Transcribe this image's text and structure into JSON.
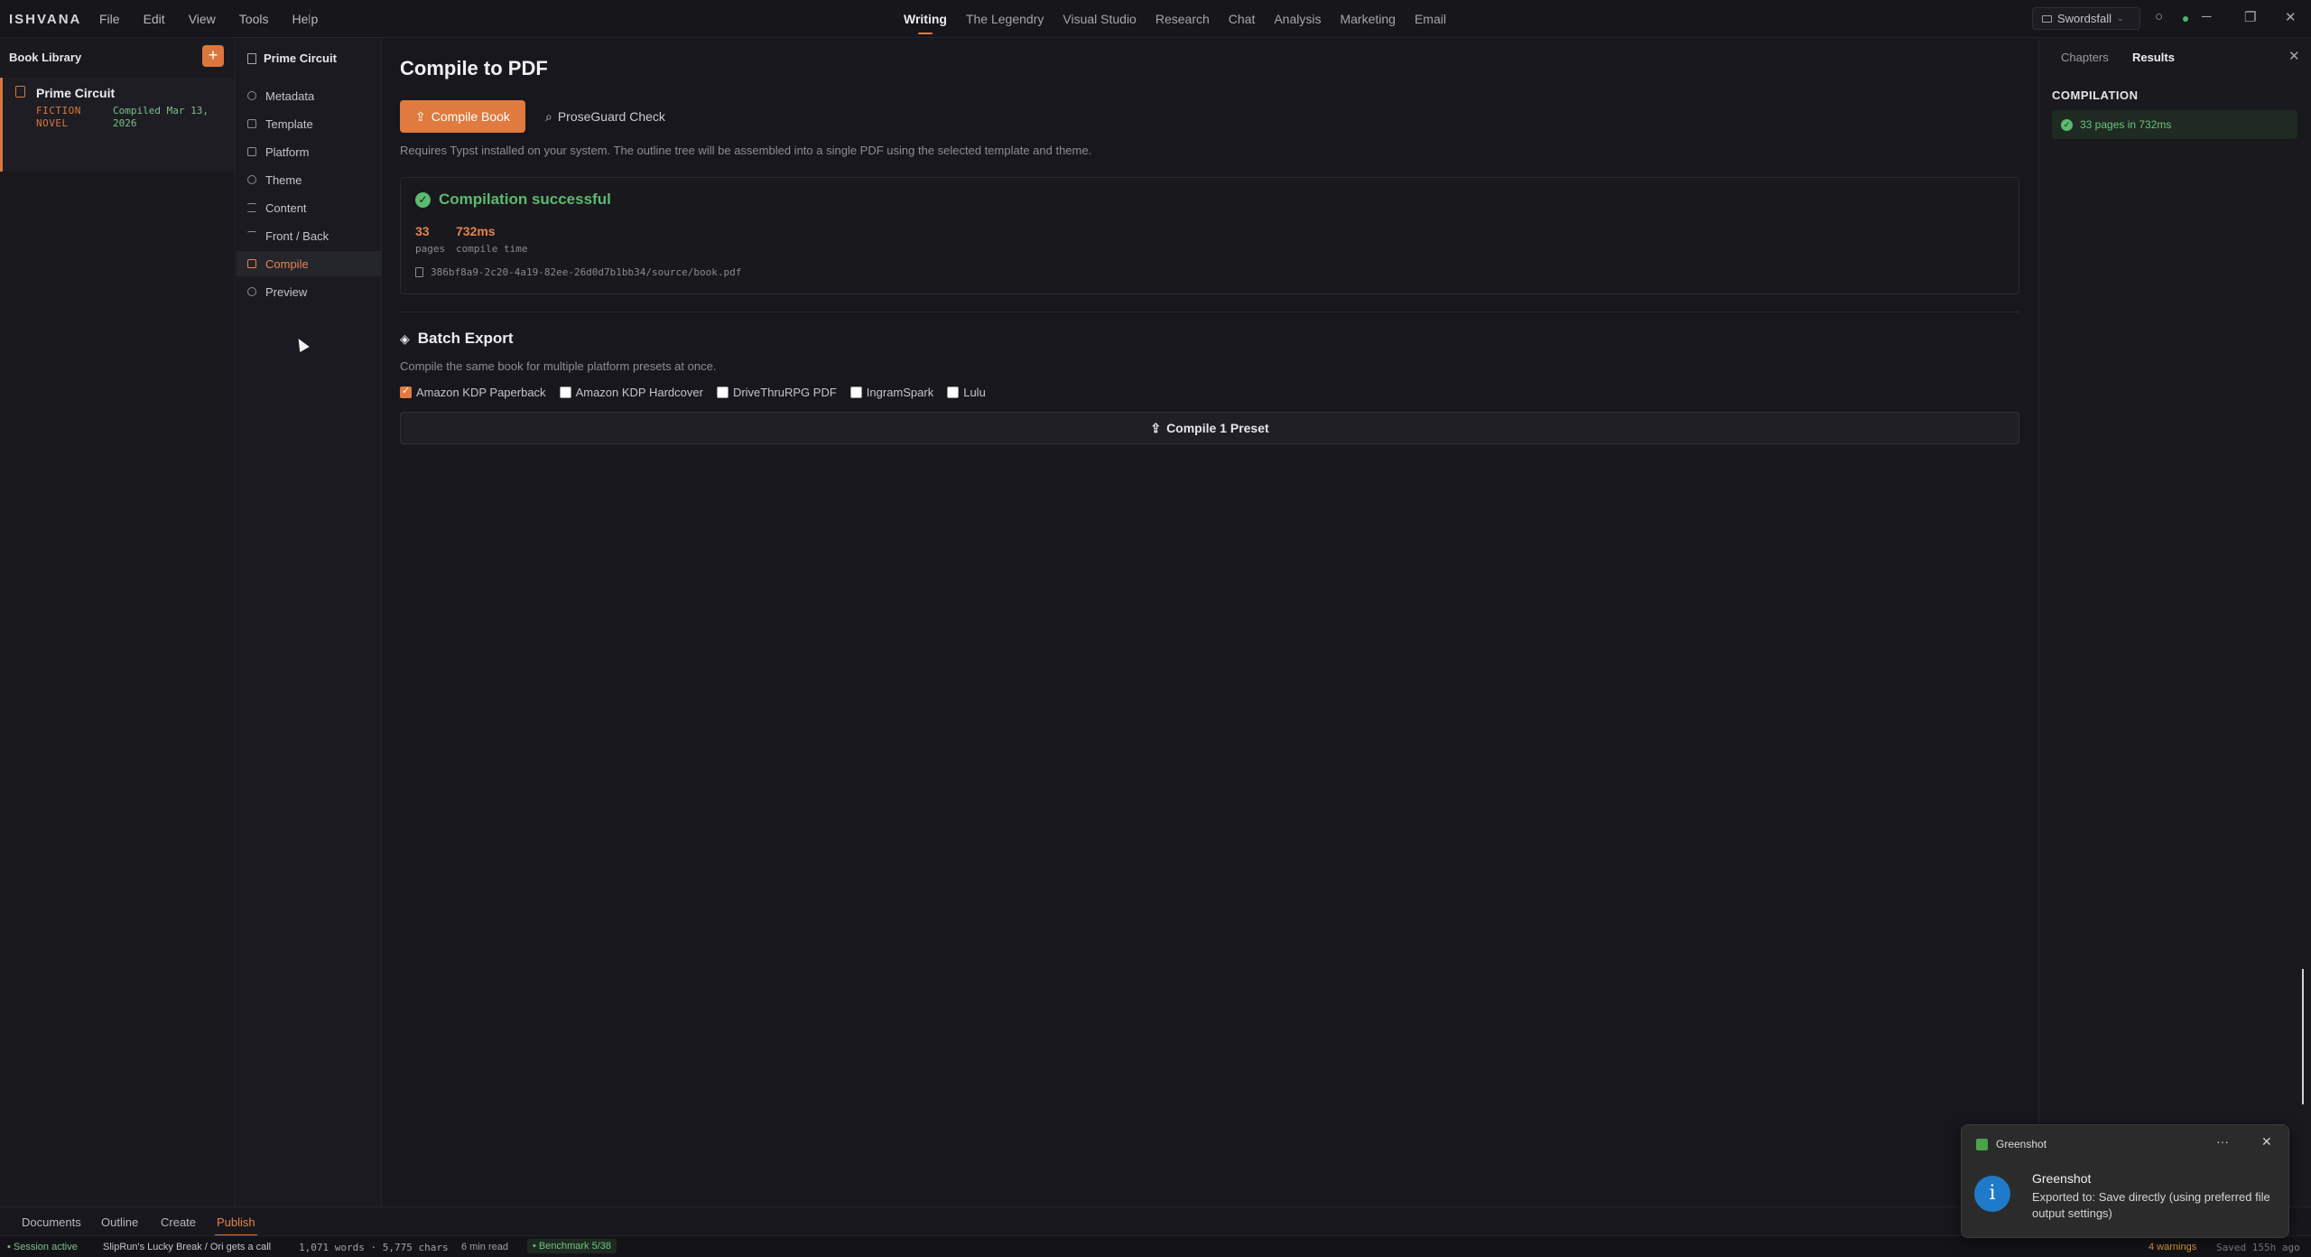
{
  "app": {
    "brand": "ISHVANA"
  },
  "menus": [
    "File",
    "Edit",
    "View",
    "Tools",
    "Help"
  ],
  "modes": [
    {
      "label": "Writing",
      "active": true
    },
    {
      "label": "The Legendry",
      "active": false
    },
    {
      "label": "Visual Studio",
      "active": false
    },
    {
      "label": "Research",
      "active": false
    },
    {
      "label": "Chat",
      "active": false
    },
    {
      "label": "Analysis",
      "active": false
    },
    {
      "label": "Marketing",
      "active": false
    },
    {
      "label": "Email",
      "active": false
    }
  ],
  "project": {
    "name": "Swordsfall",
    "icon": "folder-icon"
  },
  "library": {
    "title": "Book Library",
    "add_label": "+",
    "book": {
      "title": "Prime Circuit",
      "genre": "FICTION NOVEL",
      "compiled": "Compiled Mar 13, 2026"
    }
  },
  "nav": {
    "title": "Prime Circuit",
    "items": [
      {
        "label": "Metadata",
        "icon": "info-icon"
      },
      {
        "label": "Template",
        "icon": "layout-icon"
      },
      {
        "label": "Platform",
        "icon": "printer-icon"
      },
      {
        "label": "Theme",
        "icon": "palette-icon"
      },
      {
        "label": "Content",
        "icon": "list-icon"
      },
      {
        "label": "Front / Back",
        "icon": "text-icon"
      },
      {
        "label": "Compile",
        "icon": "export-icon"
      },
      {
        "label": "Preview",
        "icon": "eye-icon"
      }
    ],
    "active": "Compile"
  },
  "main": {
    "title": "Compile to PDF",
    "compile_button": "Compile Book",
    "proseguard_button": "ProseGuard Check",
    "requirement": "Requires Typst installed on your system. The outline tree will be assembled into a single PDF using the selected template and theme.",
    "result": {
      "title": "Compilation successful",
      "pages_value": "33",
      "pages_label": "pages",
      "time_value": "732ms",
      "time_label": "compile time",
      "path": "386bf8a9-2c20-4a19-82ee-26d0d7b1bb34/source/book.pdf"
    },
    "batch": {
      "title": "Batch Export",
      "description": "Compile the same book for multiple platform presets at once.",
      "presets": [
        {
          "label": "Amazon KDP Paperback",
          "checked": true
        },
        {
          "label": "Amazon KDP Hardcover",
          "checked": false
        },
        {
          "label": "DriveThruRPG PDF",
          "checked": false
        },
        {
          "label": "IngramSpark",
          "checked": false
        },
        {
          "label": "Lulu",
          "checked": false
        }
      ],
      "button": "Compile 1 Preset"
    }
  },
  "right_panel": {
    "tabs": [
      "Chapters",
      "Results"
    ],
    "active_tab": "Results",
    "section": "COMPILATION",
    "result": "33 pages in 732ms"
  },
  "bottom_tabs": [
    {
      "label": "Documents",
      "active": false
    },
    {
      "label": "Outline",
      "active": false
    },
    {
      "label": "Create",
      "active": false
    },
    {
      "label": "Publish",
      "active": true
    }
  ],
  "statusbar": {
    "session": "• Session active",
    "scene": "SlipRun's Lucky Break / Ori gets a call",
    "counts": "1,071 words · 5,775 chars",
    "read": "6 min read",
    "benchmark": "• Benchmark 5/38",
    "warnings": "4 warnings",
    "saved": "Saved 155h ago"
  },
  "toast": {
    "app": "Greenshot",
    "more": "···",
    "close": "✕",
    "title": "Greenshot",
    "message": "Exported to: Save directly (using preferred file output settings)"
  },
  "colors": {
    "accent": "#e07a3f",
    "success": "#5cba6f",
    "background": "#17171d"
  }
}
